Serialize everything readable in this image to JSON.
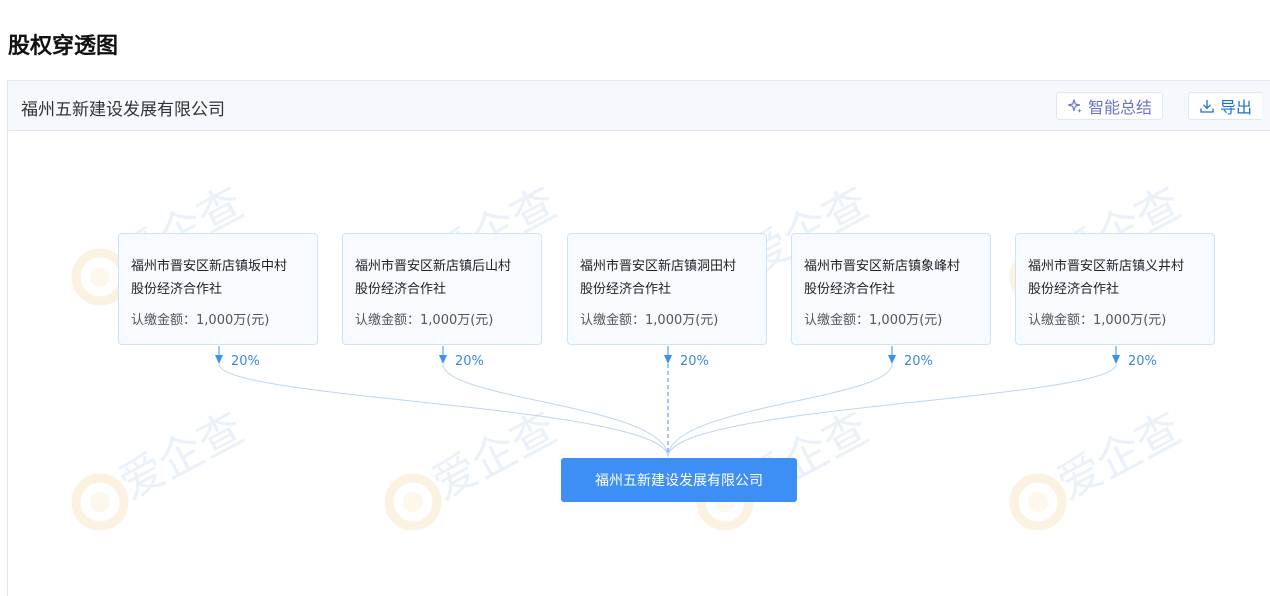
{
  "page": {
    "title": "股权穿透图"
  },
  "header": {
    "company_name": "福州五新建设发展有限公司",
    "ai_button_label": "智能总结",
    "ai_icon": "sparkle-icon",
    "export_button_label": "导出",
    "export_icon": "download-icon"
  },
  "watermark": {
    "text": "爱企查"
  },
  "shareholders": [
    {
      "name_line1": "福州市晋安区新店镇坂中村",
      "name_line2": "股份经济合作社",
      "amount_label": "认缴金额：",
      "amount": "1,000万(元)",
      "percent": "20%"
    },
    {
      "name_line1": "福州市晋安区新店镇后山村",
      "name_line2": "股份经济合作社",
      "amount_label": "认缴金额：",
      "amount": "1,000万(元)",
      "percent": "20%"
    },
    {
      "name_line1": "福州市晋安区新店镇洞田村",
      "name_line2": "股份经济合作社",
      "amount_label": "认缴金额：",
      "amount": "1,000万(元)",
      "percent": "20%"
    },
    {
      "name_line1": "福州市晋安区新店镇象峰村",
      "name_line2": "股份经济合作社",
      "amount_label": "认缴金额：",
      "amount": "1,000万(元)",
      "percent": "20%"
    },
    {
      "name_line1": "福州市晋安区新店镇义井村",
      "name_line2": "股份经济合作社",
      "amount_label": "认缴金额：",
      "amount": "1,000万(元)",
      "percent": "20%"
    }
  ],
  "target": {
    "name": "福州五新建设发展有限公司"
  },
  "colors": {
    "accent": "#3d8ff5",
    "line": "#bcd6f7",
    "card_border": "#cfe2fb"
  }
}
